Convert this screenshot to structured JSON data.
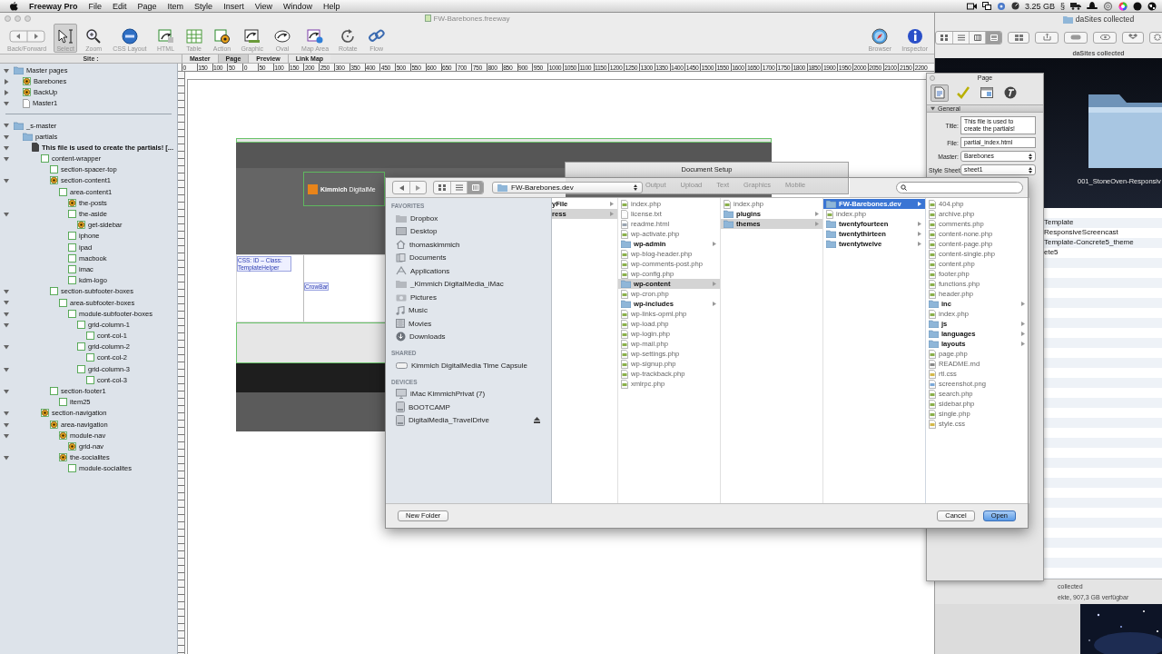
{
  "menu_bar": {
    "app": "Freeway Pro",
    "menus": [
      "File",
      "Edit",
      "Page",
      "Item",
      "Style",
      "Insert",
      "View",
      "Window",
      "Help"
    ],
    "memory": "3.25 GB",
    "symbol": "§"
  },
  "main_window": {
    "title": "FW-Barebones.freeway",
    "tools": [
      {
        "label": "Back/Forward",
        "kind": "nav",
        "selected": false
      },
      {
        "label": "Select",
        "kind": "select",
        "selected": true
      },
      {
        "label": "Zoom",
        "kind": "zoom",
        "selected": false
      },
      {
        "label": "CSS Layout",
        "kind": "css",
        "selected": false
      },
      {
        "label": "HTML",
        "kind": "html",
        "selected": false
      },
      {
        "label": "Table",
        "kind": "table",
        "selected": false
      },
      {
        "label": "Action",
        "kind": "action",
        "selected": false
      },
      {
        "label": "Graphic",
        "kind": "graphic",
        "selected": false
      },
      {
        "label": "Oval",
        "kind": "oval",
        "selected": false
      },
      {
        "label": "Map Area",
        "kind": "maparea",
        "selected": false
      },
      {
        "label": "Rotate",
        "kind": "rotate",
        "selected": false
      },
      {
        "label": "Flow",
        "kind": "flow",
        "selected": false
      }
    ],
    "right_tools": [
      {
        "label": "Browser",
        "kind": "browser"
      },
      {
        "label": "Inspector",
        "kind": "inspector"
      }
    ],
    "site_label": "Site :",
    "tabs": [
      {
        "label": "Master",
        "selected": false
      },
      {
        "label": "Page",
        "selected": true
      },
      {
        "label": "Preview",
        "selected": false
      },
      {
        "label": "Link Map",
        "selected": false
      }
    ],
    "tree": [
      {
        "label": "Master pages",
        "kind": "folder",
        "expanded": true,
        "children": [
          {
            "label": "Barebones",
            "kind": "gear",
            "expanded": false
          },
          {
            "label": "BackUp",
            "kind": "gear",
            "expanded": false
          },
          {
            "label": "Master1",
            "kind": "page",
            "expanded": true
          }
        ]
      },
      {
        "label": "_s-master",
        "kind": "folder",
        "expanded": true,
        "children": [
          {
            "label": "partials",
            "kind": "folder",
            "expanded": true,
            "children": [
              {
                "label": "This file is used to create the partials! [...",
                "kind": "doc",
                "expanded": true,
                "children": [
                  {
                    "label": "content-wrapper",
                    "kind": "box",
                    "expanded": true,
                    "children": [
                      {
                        "label": "section-spacer-top",
                        "kind": "box"
                      },
                      {
                        "label": "section-content1",
                        "kind": "gear",
                        "expanded": true,
                        "children": [
                          {
                            "label": "area-content1",
                            "kind": "box",
                            "children": [
                              {
                                "label": "the-posts",
                                "kind": "gear"
                              },
                              {
                                "label": "the-aside",
                                "kind": "box",
                                "expanded": true,
                                "children": [
                                  {
                                    "label": "get-sidebar",
                                    "kind": "gear"
                                  }
                                ]
                              },
                              {
                                "label": "iphone",
                                "kind": "box"
                              },
                              {
                                "label": "ipad",
                                "kind": "box"
                              },
                              {
                                "label": "macbook",
                                "kind": "box"
                              },
                              {
                                "label": "imac",
                                "kind": "box"
                              },
                              {
                                "label": "kdm-logo",
                                "kind": "box"
                              }
                            ]
                          }
                        ]
                      },
                      {
                        "label": "section-subfooter-boxes",
                        "kind": "box",
                        "expanded": true,
                        "children": [
                          {
                            "label": "area-subfooter-boxes",
                            "kind": "box",
                            "expanded": true,
                            "children": [
                              {
                                "label": "module-subfooter-boxes",
                                "kind": "box",
                                "expanded": true,
                                "children": [
                                  {
                                    "label": "grid-column-1",
                                    "kind": "box",
                                    "expanded": true,
                                    "children": [
                                      {
                                        "label": "cont-col-1",
                                        "kind": "box"
                                      }
                                    ]
                                  },
                                  {
                                    "label": "grid-column-2",
                                    "kind": "box",
                                    "expanded": true,
                                    "children": [
                                      {
                                        "label": "cont-col-2",
                                        "kind": "box"
                                      }
                                    ]
                                  },
                                  {
                                    "label": "grid-column-3",
                                    "kind": "box",
                                    "expanded": true,
                                    "children": [
                                      {
                                        "label": "cont-col-3",
                                        "kind": "box"
                                      }
                                    ]
                                  }
                                ]
                              }
                            ]
                          }
                        ]
                      },
                      {
                        "label": "section-footer1",
                        "kind": "box",
                        "expanded": true,
                        "children": [
                          {
                            "label": "item25",
                            "kind": "box"
                          }
                        ]
                      }
                    ]
                  },
                  {
                    "label": "section-navigation",
                    "kind": "gear",
                    "expanded": true,
                    "children": [
                      {
                        "label": "area-navigation",
                        "kind": "gear",
                        "expanded": true,
                        "children": [
                          {
                            "label": "module-nav",
                            "kind": "gear",
                            "expanded": true,
                            "children": [
                              {
                                "label": "grid-nav",
                                "kind": "gear"
                              }
                            ]
                          },
                          {
                            "label": "the-socialites",
                            "kind": "gear",
                            "expanded": true,
                            "children": [
                              {
                                "label": "module-socialites",
                                "kind": "box"
                              }
                            ]
                          }
                        ]
                      }
                    ]
                  }
                ]
              }
            ]
          }
        ]
      }
    ],
    "ruler": [
      "0",
      "150",
      "100",
      "50",
      "0",
      "50",
      "100",
      "150",
      "200",
      "250",
      "300",
      "350",
      "400",
      "450",
      "500",
      "550",
      "600",
      "650",
      "700",
      "750",
      "800",
      "850",
      "900",
      "950",
      "1000",
      "1050",
      "1100",
      "1150",
      "1200",
      "1250",
      "1300",
      "1350",
      "1400",
      "1450",
      "1500",
      "1550",
      "1600",
      "1650",
      "1700",
      "1750",
      "1800",
      "1850",
      "1900",
      "1950",
      "2000",
      "2050",
      "2100",
      "2150",
      "2200"
    ],
    "design": {
      "logo": "**Kimmich** DigitalMe",
      "note": "CSS: ID – Class: TemplateHelper",
      "tag": "CrowBar"
    }
  },
  "inspector": {
    "title": "Page",
    "tabs": [
      {
        "kind": "page",
        "selected": true
      },
      {
        "kind": "check",
        "selected": false
      },
      {
        "kind": "window",
        "selected": false
      },
      {
        "kind": "type",
        "selected": false
      }
    ],
    "section": "General",
    "fields": [
      {
        "label": "Title:",
        "value": "This file is used to create the partials!",
        "kind": "textarea"
      },
      {
        "label": "File:",
        "value": "partial_index.html",
        "kind": "text"
      },
      {
        "label": "Master:",
        "value": "Barebones",
        "kind": "select"
      },
      {
        "label": "Style Sheet:",
        "value": "sheet1",
        "kind": "select"
      }
    ]
  },
  "finder": {
    "title": "daSites collected",
    "views": [
      {
        "kind": "icon",
        "selected": false
      },
      {
        "kind": "list",
        "selected": false
      },
      {
        "kind": "column",
        "selected": false
      },
      {
        "kind": "cover",
        "selected": true
      }
    ],
    "path_label": "daSites collected",
    "preview_label": "001_StoneOven-Responsiv",
    "rows": [
      "Template",
      "ResponsiveScreencast",
      "Template-Concrete5_theme",
      "ete5"
    ],
    "status": [
      "collected",
      "ekte, 907,3 GB verfügbar"
    ]
  },
  "document_setup": {
    "title": "Document Setup",
    "tabs": [
      "Output",
      "Upload",
      "Text",
      "Graphics",
      "Mobile"
    ]
  },
  "open_dialog": {
    "views": [
      {
        "kind": "icon",
        "selected": false
      },
      {
        "kind": "list",
        "selected": false
      },
      {
        "kind": "column",
        "selected": true
      }
    ],
    "path": "FW-Barebones.dev",
    "sidebar": [
      {
        "heading": "FAVORITES",
        "items": [
          {
            "label": "Dropbox",
            "kind": "folder"
          },
          {
            "label": "Desktop",
            "kind": "desktop"
          },
          {
            "label": "thomaskimmich",
            "kind": "home"
          },
          {
            "label": "Documents",
            "kind": "documents"
          },
          {
            "label": "Applications",
            "kind": "apps"
          },
          {
            "label": "_Kimmich DigitalMedia_iMac",
            "kind": "folder"
          },
          {
            "label": "Pictures",
            "kind": "pictures"
          },
          {
            "label": "Music",
            "kind": "music"
          },
          {
            "label": "Movies",
            "kind": "movies"
          },
          {
            "label": "Downloads",
            "kind": "downloads"
          }
        ]
      },
      {
        "heading": "SHARED",
        "items": [
          {
            "label": "Kimmich DigitalMedia Time Capsule",
            "kind": "capsule"
          }
        ]
      },
      {
        "heading": "DEVICES",
        "items": [
          {
            "label": "iMac KimmichPrivat (7)",
            "kind": "imac"
          },
          {
            "label": "BOOTCAMP",
            "kind": "disk"
          },
          {
            "label": "DigitalMedia_TravelDrive",
            "kind": "disk",
            "ejectable": true
          }
        ]
      }
    ],
    "columns": [
      {
        "focused": false,
        "clipped": true,
        "items": [
          {
            "name": "yFile",
            "kind": "folder",
            "selected": false
          },
          {
            "name": "ress",
            "kind": "folder",
            "selected": true
          }
        ]
      },
      {
        "focused": false,
        "clipped": false,
        "items": [
          {
            "name": "index.php",
            "kind": "php",
            "selected": false
          },
          {
            "name": "license.txt",
            "kind": "txt",
            "selected": false
          },
          {
            "name": "readme.html",
            "kind": "html",
            "selected": false
          },
          {
            "name": "wp-activate.php",
            "kind": "php",
            "selected": false
          },
          {
            "name": "wp-admin",
            "kind": "folder",
            "selected": false
          },
          {
            "name": "wp-blog-header.php",
            "kind": "php",
            "selected": false
          },
          {
            "name": "wp-comments-post.php",
            "kind": "php",
            "selected": false
          },
          {
            "name": "wp-config.php",
            "kind": "php",
            "selected": false
          },
          {
            "name": "wp-content",
            "kind": "folder",
            "selected": true
          },
          {
            "name": "wp-cron.php",
            "kind": "php",
            "selected": false
          },
          {
            "name": "wp-includes",
            "kind": "folder",
            "selected": false
          },
          {
            "name": "wp-links-opml.php",
            "kind": "php",
            "selected": false
          },
          {
            "name": "wp-load.php",
            "kind": "php",
            "selected": false
          },
          {
            "name": "wp-login.php",
            "kind": "php",
            "selected": false
          },
          {
            "name": "wp-mail.php",
            "kind": "php",
            "selected": false
          },
          {
            "name": "wp-settings.php",
            "kind": "php",
            "selected": false
          },
          {
            "name": "wp-signup.php",
            "kind": "php",
            "selected": false
          },
          {
            "name": "wp-trackback.php",
            "kind": "php",
            "selected": false
          },
          {
            "name": "xmlrpc.php",
            "kind": "php",
            "selected": false
          }
        ]
      },
      {
        "focused": false,
        "clipped": false,
        "items": [
          {
            "name": "index.php",
            "kind": "php",
            "selected": false
          },
          {
            "name": "plugins",
            "kind": "folder",
            "selected": false
          },
          {
            "name": "themes",
            "kind": "folder",
            "selected": true
          }
        ]
      },
      {
        "focused": true,
        "clipped": false,
        "items": [
          {
            "name": "FW-Barebones.dev",
            "kind": "folder",
            "selected": true
          },
          {
            "name": "index.php",
            "kind": "php",
            "selected": false
          },
          {
            "name": "twentyfourteen",
            "kind": "folder",
            "selected": false
          },
          {
            "name": "twentythirteen",
            "kind": "folder",
            "selected": false
          },
          {
            "name": "twentytwelve",
            "kind": "folder",
            "selected": false
          }
        ]
      },
      {
        "focused": false,
        "clipped": false,
        "items": [
          {
            "name": "404.php",
            "kind": "php",
            "selected": false
          },
          {
            "name": "archive.php",
            "kind": "php",
            "selected": false
          },
          {
            "name": "comments.php",
            "kind": "php",
            "selected": false
          },
          {
            "name": "content-none.php",
            "kind": "php",
            "selected": false
          },
          {
            "name": "content-page.php",
            "kind": "php",
            "selected": false
          },
          {
            "name": "content-single.php",
            "kind": "php",
            "selected": false
          },
          {
            "name": "content.php",
            "kind": "php",
            "selected": false
          },
          {
            "name": "footer.php",
            "kind": "php",
            "selected": false
          },
          {
            "name": "functions.php",
            "kind": "php",
            "selected": false
          },
          {
            "name": "header.php",
            "kind": "php",
            "selected": false
          },
          {
            "name": "inc",
            "kind": "folder",
            "selected": false
          },
          {
            "name": "index.php",
            "kind": "php",
            "selected": false
          },
          {
            "name": "js",
            "kind": "folder",
            "selected": false
          },
          {
            "name": "languages",
            "kind": "folder",
            "selected": false
          },
          {
            "name": "layouts",
            "kind": "folder",
            "selected": false
          },
          {
            "name": "page.php",
            "kind": "php",
            "selected": false
          },
          {
            "name": "README.md",
            "kind": "md",
            "selected": false
          },
          {
            "name": "rtl.css",
            "kind": "css",
            "selected": false
          },
          {
            "name": "screenshot.png",
            "kind": "png",
            "selected": false
          },
          {
            "name": "search.php",
            "kind": "php",
            "selected": false
          },
          {
            "name": "sidebar.php",
            "kind": "php",
            "selected": false
          },
          {
            "name": "single.php",
            "kind": "php",
            "selected": false
          },
          {
            "name": "style.css",
            "kind": "css",
            "selected": false
          }
        ]
      }
    ],
    "buttons": {
      "new_folder": "New Folder",
      "cancel": "Cancel",
      "open": "Open"
    }
  }
}
